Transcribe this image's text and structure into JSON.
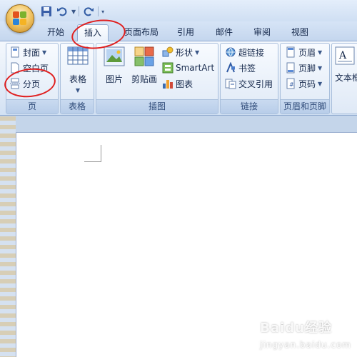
{
  "quick_access": {
    "items": [
      "save-icon",
      "undo-icon",
      "redo-icon"
    ]
  },
  "tabs": [
    {
      "label": "开始"
    },
    {
      "label": "插入"
    },
    {
      "label": "页面布局"
    },
    {
      "label": "引用"
    },
    {
      "label": "邮件"
    },
    {
      "label": "审阅"
    },
    {
      "label": "视图"
    }
  ],
  "active_tab": "插入",
  "ribbon": {
    "pages": {
      "label": "页",
      "cover": "封面",
      "blank": "空白页",
      "break": "分页"
    },
    "tables": {
      "label": "表格",
      "table": "表格"
    },
    "illustrations": {
      "label": "插图",
      "picture": "图片",
      "clipart": "剪贴画",
      "shapes": "形状",
      "smartart": "SmartArt",
      "chart": "图表"
    },
    "links": {
      "label": "链接",
      "hyperlink": "超链接",
      "bookmark": "书签",
      "crossref": "交叉引用"
    },
    "header_footer": {
      "label": "页眉和页脚",
      "header": "页眉",
      "footer": "页脚",
      "page_number": "页码"
    },
    "text": {
      "textbox": "文本框"
    }
  },
  "watermark": {
    "text": "Baidu经验",
    "sub": "jingyan.baidu.com"
  },
  "colors": {
    "annotation": "#e02020",
    "ribbon_group_label": "#b8cde9"
  }
}
